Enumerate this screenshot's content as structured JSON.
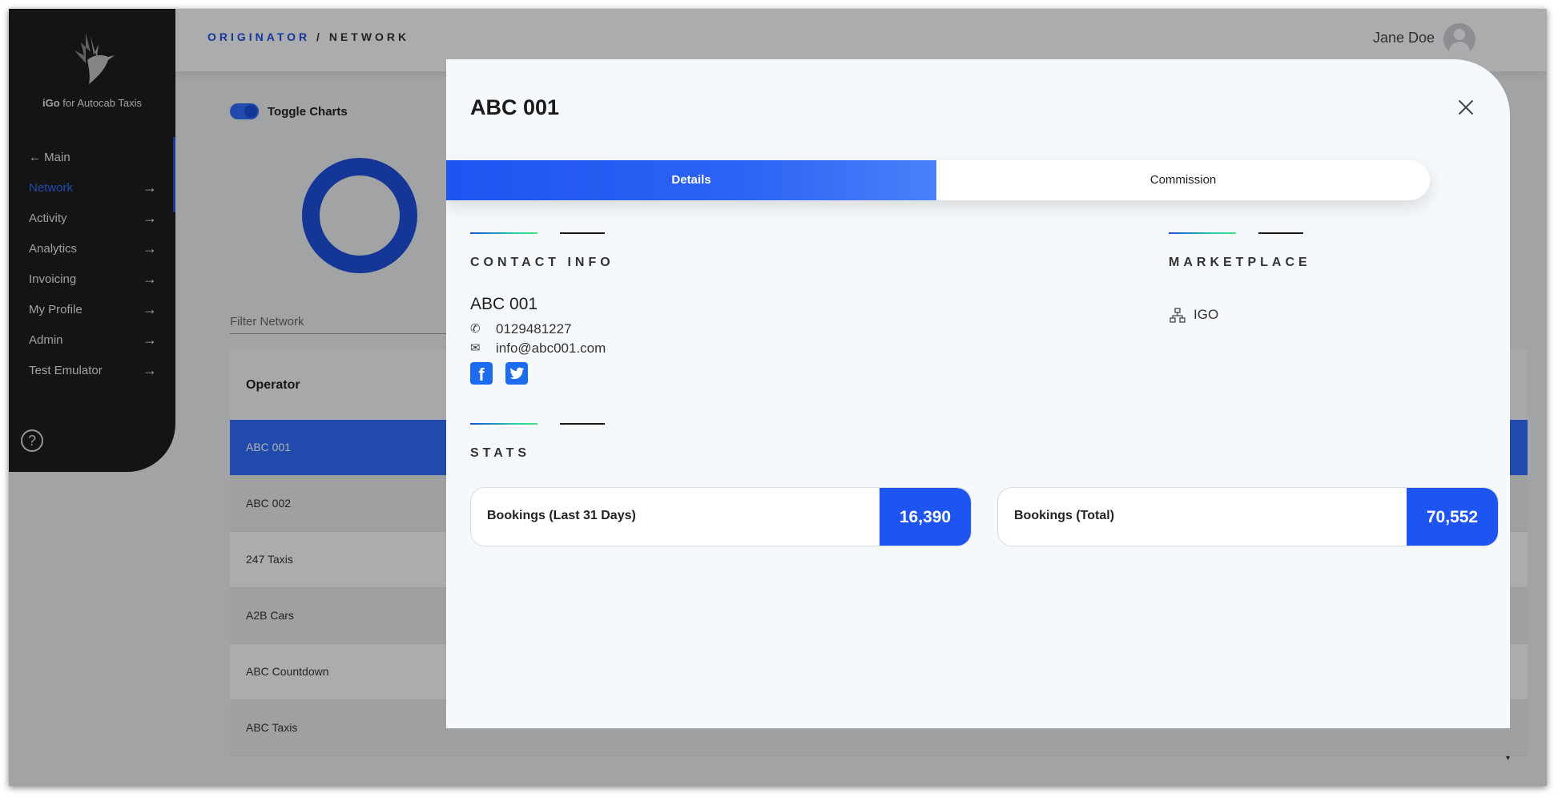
{
  "app": {
    "logo_bold": "iGo",
    "logo_rest": " for Autocab Taxis"
  },
  "breadcrumb": {
    "parent": "ORIGINATOR",
    "separator": " / ",
    "current": "NETWORK"
  },
  "user": {
    "name": "Jane Doe"
  },
  "sidebar": {
    "back_label": "Main",
    "items": [
      {
        "label": "Network",
        "active": true
      },
      {
        "label": "Activity"
      },
      {
        "label": "Analytics"
      },
      {
        "label": "Invoicing"
      },
      {
        "label": "My Profile"
      },
      {
        "label": "Admin"
      },
      {
        "label": "Test Emulator"
      }
    ],
    "help_glyph": "?"
  },
  "page": {
    "toggle_label": "Toggle Charts",
    "filter_placeholder": "Filter Network",
    "table_header": "Operator",
    "rows": [
      "ABC 001",
      "ABC 002",
      "247 Taxis",
      "A2B Cars",
      "ABC Countdown",
      "ABC Taxis"
    ],
    "selected_row": "ABC 001"
  },
  "modal": {
    "title": "ABC 001",
    "tabs": [
      {
        "label": "Details",
        "active": true
      },
      {
        "label": "Commission"
      }
    ],
    "contact": {
      "section_title": "CONTACT INFO",
      "name": "ABC 001",
      "phone": "0129481227",
      "email": "info@abc001.com",
      "social_icons": [
        "facebook-icon",
        "twitter-icon"
      ]
    },
    "marketplace": {
      "section_title": "MARKETPLACE",
      "value": "IGO"
    },
    "stats": {
      "section_title": "STATS",
      "cards": [
        {
          "label": "Bookings (Last 31 Days)",
          "value": "16,390"
        },
        {
          "label": "Bookings (Total)",
          "value": "70,552"
        }
      ]
    }
  },
  "colors": {
    "accent": "#1e54f0",
    "sidebar_bg": "#1e1e1e",
    "modal_bg": "#f6f9fc"
  }
}
